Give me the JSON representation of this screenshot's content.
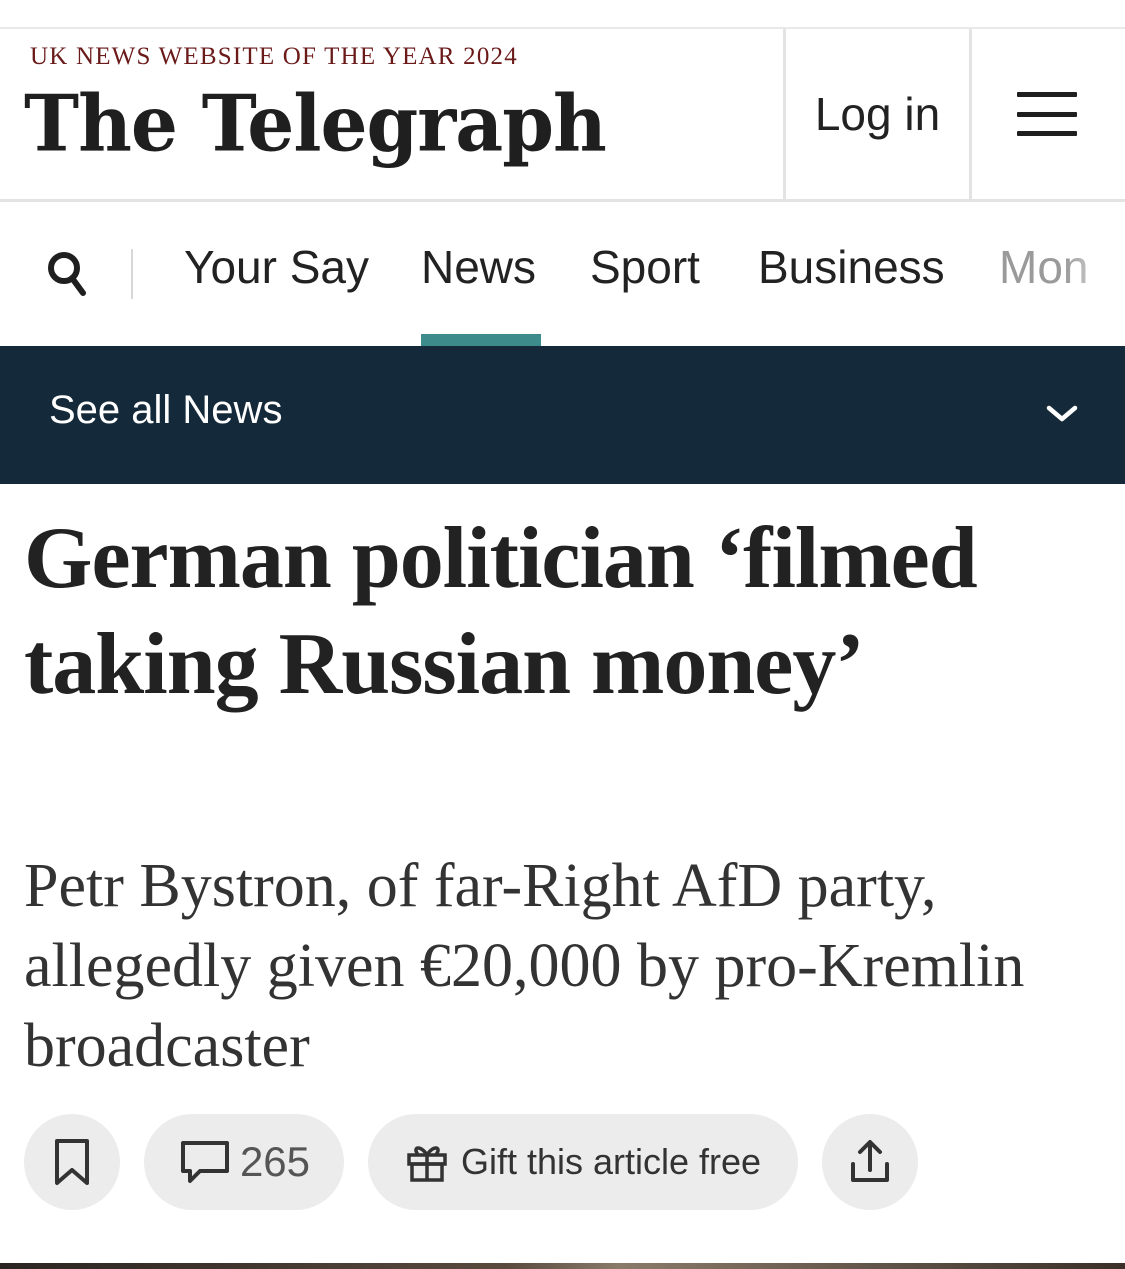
{
  "masthead": {
    "award": "UK NEWS WEBSITE OF THE YEAR 2024",
    "logo": "The Telegraph",
    "login_label": "Log in"
  },
  "nav": {
    "items": [
      "Your Say",
      "News",
      "Sport",
      "Business",
      "Mon"
    ],
    "active": "News"
  },
  "section": {
    "label": "See all News"
  },
  "article": {
    "headline": "German politician ‘filmed taking Russian money’",
    "standfirst": "Petr Bystron, of far-Right AfD party, allegedly given €20,000 by pro-Kremlin broadcaster",
    "comment_count": "265",
    "gift_label": "Gift this article free"
  },
  "colors": {
    "accent": "#3e8b8b",
    "section_bar": "#142a3a",
    "award_red": "#6b1a1a"
  },
  "icons": [
    "search-icon",
    "hamburger-menu-icon",
    "chevron-down-icon",
    "bookmark-icon",
    "comment-icon",
    "gift-icon",
    "share-icon"
  ]
}
